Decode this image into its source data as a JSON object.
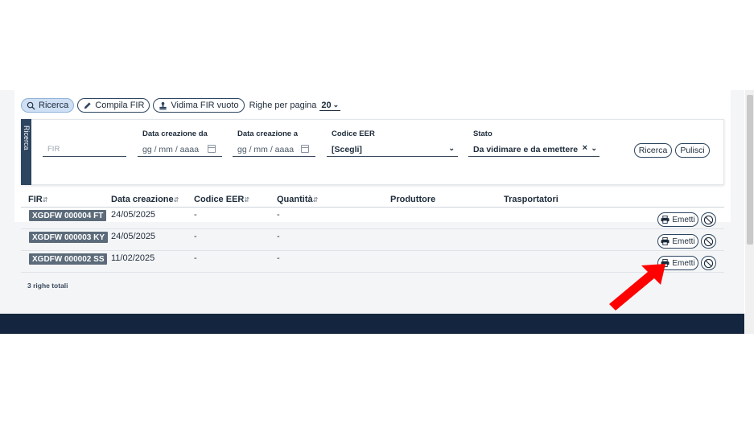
{
  "toolbar": {
    "search_label": "Ricerca",
    "compile_label": "Compila FIR",
    "validate_label": "Vidima FIR vuoto",
    "rows_per_page_label": "Righe per pagina",
    "rows_per_page_value": "20"
  },
  "filters": {
    "panel_tab": "Ricerca",
    "fir_placeholder": "FIR",
    "date_from_label": "Data creazione da",
    "date_from_placeholder": "gg / mm / aaaa",
    "date_to_label": "Data creazione a",
    "date_to_placeholder": "gg / mm / aaaa",
    "eer_label": "Codice EER",
    "eer_value": "[Scegli]",
    "state_label": "Stato",
    "state_value": "Da vidimare e da emettere",
    "search_button": "Ricerca",
    "clear_button": "Pulisci"
  },
  "table": {
    "columns": [
      "FIR",
      "Data creazione",
      "Codice EER",
      "Quantità",
      "Produttore",
      "Trasportatori"
    ],
    "rows": [
      {
        "fir": "XGDFW 000004 FT",
        "date": "24/05/2025",
        "eer": "-",
        "qty": "-",
        "action": "Emetti"
      },
      {
        "fir": "XGDFW 000003 KY",
        "date": "24/05/2025",
        "eer": "-",
        "qty": "-",
        "action": "Emetti"
      },
      {
        "fir": "XGDFW 000002 SS",
        "date": "11/02/2025",
        "eer": "-",
        "qty": "-",
        "action": "Emetti"
      }
    ],
    "total": "3 righe totali"
  },
  "colors": {
    "navy": "#14263f",
    "accent": "#2c4560",
    "badge": "#5c6b7a",
    "active_pill": "#cfe0f5",
    "arrow": "#ff0000"
  },
  "icons": [
    "search-icon",
    "pencil-icon",
    "stamp-icon",
    "chevron-down-icon",
    "calendar-icon",
    "clear-icon",
    "sort-icon",
    "printer-icon",
    "ban-icon",
    "arrow-icon"
  ]
}
